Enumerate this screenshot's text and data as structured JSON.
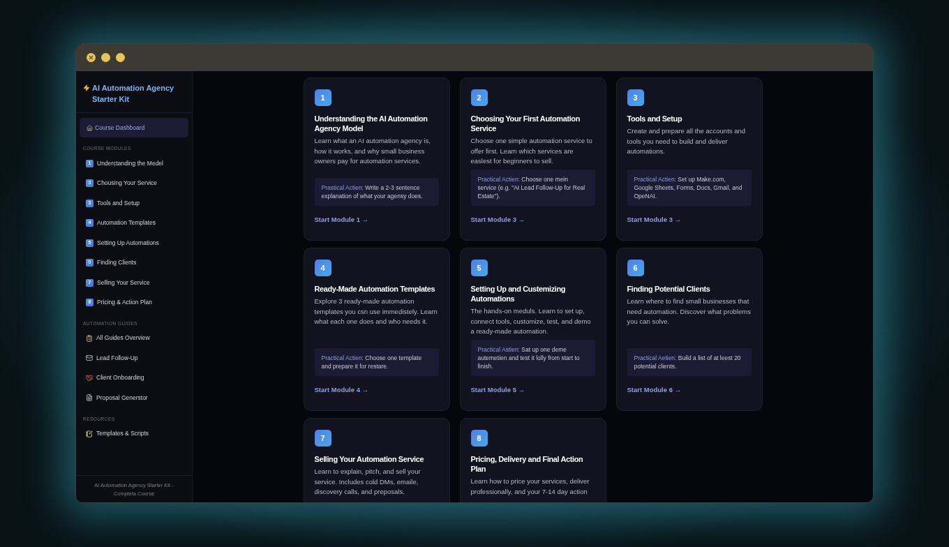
{
  "window": {
    "controls": [
      {
        "kind": "close"
      },
      {
        "kind": "minimize"
      },
      {
        "kind": "zoom"
      }
    ]
  },
  "sidebar": {
    "title": "AI Automation Agency Starter Kit",
    "dashboard": {
      "label": "Course Dashboard",
      "selected": true
    },
    "sections": [
      {
        "heading": "COURSE MODULES",
        "items": [
          {
            "kind": "number",
            "badge": "1",
            "label": "Underctanding the Medel",
            "selected": false
          },
          {
            "kind": "number",
            "badge": "3",
            "label": "Chousing Your Service",
            "selected": false
          },
          {
            "kind": "number",
            "badge": "3",
            "label": "Tools and Setup",
            "selected": false
          },
          {
            "kind": "number",
            "badge": "4",
            "label": "Automation Templates",
            "selected": false
          },
          {
            "kind": "number",
            "badge": "5",
            "label": "Setting Up Automations",
            "selected": false
          },
          {
            "kind": "number",
            "badge": "0",
            "label": "Finding Clients",
            "selected": false
          },
          {
            "kind": "number",
            "badge": "7",
            "label": "Selling Your Service",
            "selected": false
          },
          {
            "kind": "number",
            "badge": "8",
            "label": "Pricing & Action Plan",
            "selected": false
          }
        ]
      },
      {
        "heading": "AUTOMATION GUIDES",
        "items": [
          {
            "kind": "clipboard",
            "label": "All Guides Overview",
            "selected": false
          },
          {
            "kind": "mail",
            "label": "Lead Follow-Up",
            "selected": false
          },
          {
            "kind": "handshake",
            "label": "Client Onboarding",
            "selected": false
          },
          {
            "kind": "file",
            "label": "Proposal Generstor",
            "selected": false
          }
        ]
      },
      {
        "heading": "RESOURCES",
        "items": [
          {
            "kind": "notebook",
            "label": "Templates & Scripts",
            "selected": false
          }
        ]
      }
    ],
    "footer": "AI Automation Agency Starter Kit - Completa Course"
  },
  "modules": [
    {
      "number": "1",
      "title": "Understanding the AI Automation Agency Model",
      "description": "Learn what an AI automation agency is, how it works, and why small business owners pay for automation services.",
      "action_label": "Prastical Actien:",
      "action_text": "Write a 2-3 sentence explanation of what your agensy does.",
      "link": "Start Module 1 →"
    },
    {
      "number": "2",
      "title": "Choosing Your First Automation Service",
      "description": "Choose one simple automation service to offer first. Learn which services are easlest for beginners to sell.",
      "action_label": "Practical Actien:",
      "action_text": "Choose one mein service (e.g. \"AI Lead Follow-Up for Real Estate\").",
      "link": "Start Module 3 →"
    },
    {
      "number": "3",
      "title": "Tools and Setup",
      "description": "Create and prepare all the accounts and tools you need to build and deliver automations.",
      "action_label": "Practical Actien:",
      "action_text": "Set up Make.com, Google Sheets, Forms, Docs, Gmail, and OpeNAI.",
      "link": "Start Module 3 →"
    },
    {
      "number": "4",
      "title": "Ready-Made Automation Templates",
      "description": "Explore 3 ready-made automation templates you csn use immedistely. Learn what each one does and who needs it.",
      "action_label": "Practical Actien:",
      "action_text": "Choose one template and prepare it for restare.",
      "link": "Start Module 4 →"
    },
    {
      "number": "5",
      "title": "Setting Up and Custemizing Automations",
      "description": "The hands-on meduls. Learn to set up, connect tools, customize, test, and demo a ready-made automation.",
      "action_label": "Practical Astien:",
      "action_text": "Sat up one deme autemetien and test it lolly from start to finish.",
      "link": "Start Module 5 →"
    },
    {
      "number": "6",
      "title": "Finding Potential Clients",
      "description": "Learn where to find small businesses that need automation. Discover what problems you can solve.",
      "action_label": "Practical Aetien:",
      "action_text": "Build a list of at leest 20 potential clients.",
      "link": "Start Module 6 →"
    },
    {
      "number": "7",
      "title": "Selling Your Automation Service",
      "description": "Learn to explain, pitch, and sell your service. Includes cold DMs, emaile, discovery calls, and preposals."
    },
    {
      "number": "8",
      "title": "Pricing, Delivery and Final Action Plan",
      "description": "Learn how to price your services, deliver professionally, and your 7-14 day action"
    }
  ]
}
